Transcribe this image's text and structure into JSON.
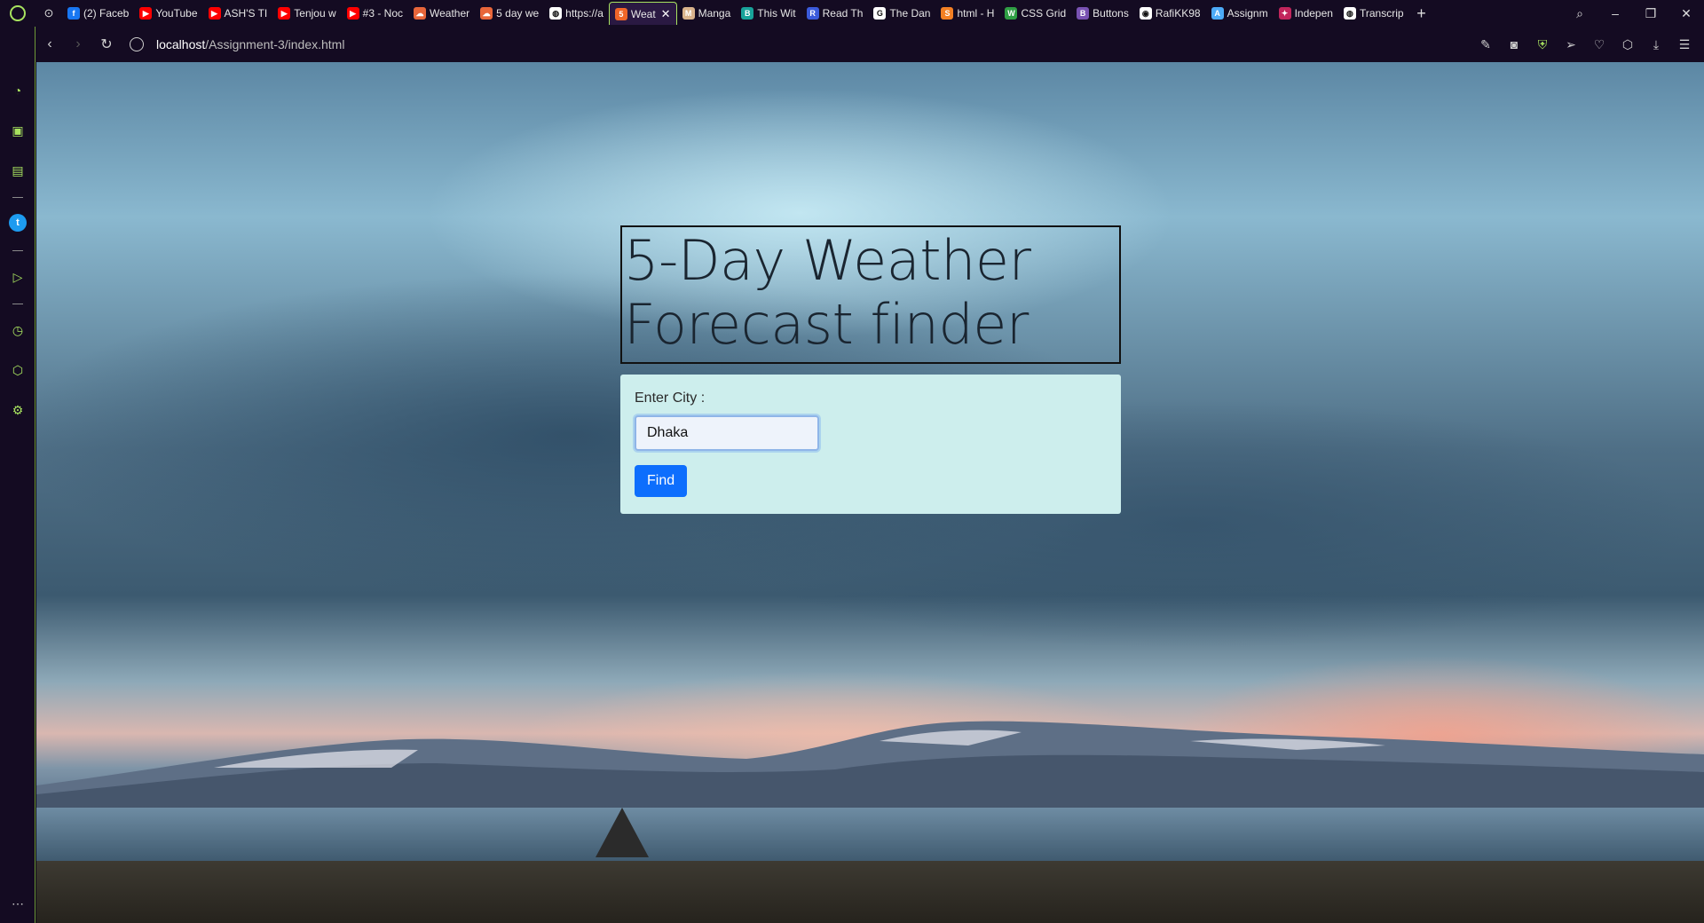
{
  "browser": {
    "tabs": [
      {
        "label": "(2) Faceb",
        "fav_color": "#1877f2",
        "fav_glyph": "f",
        "icon": "facebook-icon"
      },
      {
        "label": "YouTube",
        "fav_color": "#ff0000",
        "fav_glyph": "▶",
        "icon": "youtube-icon"
      },
      {
        "label": "ASH'S TI",
        "fav_color": "#ff0000",
        "fav_glyph": "▶",
        "icon": "youtube-icon"
      },
      {
        "label": "Tenjou w",
        "fav_color": "#ff0000",
        "fav_glyph": "▶",
        "icon": "youtube-icon"
      },
      {
        "label": "#3 - Noc",
        "fav_color": "#ff0000",
        "fav_glyph": "▶",
        "icon": "youtube-icon"
      },
      {
        "label": "Weather",
        "fav_color": "#e8663a",
        "fav_glyph": "☁",
        "icon": "weather-icon"
      },
      {
        "label": "5 day we",
        "fav_color": "#e8663a",
        "fav_glyph": "☁",
        "icon": "weather-icon"
      },
      {
        "label": "https://a",
        "fav_color": "#ffffff",
        "fav_glyph": "◍",
        "icon": "globe-icon"
      },
      {
        "label": "Weat",
        "fav_color": "#f06529",
        "fav_glyph": "5",
        "icon": "html-icon",
        "active": true
      },
      {
        "label": "Manga",
        "fav_color": "#d9b38c",
        "fav_glyph": "M",
        "icon": "manga-icon"
      },
      {
        "label": "This Wit",
        "fav_color": "#18a39a",
        "fav_glyph": "B",
        "icon": "book-icon"
      },
      {
        "label": "Read Th",
        "fav_color": "#3b5bdb",
        "fav_glyph": "R",
        "icon": "reader-icon"
      },
      {
        "label": "The Dan",
        "fav_color": "#ffffff",
        "fav_glyph": "G",
        "icon": "google-icon"
      },
      {
        "label": "html - H",
        "fav_color": "#f48024",
        "fav_glyph": "S",
        "icon": "stackoverflow-icon"
      },
      {
        "label": "CSS Grid",
        "fav_color": "#2f9e44",
        "fav_glyph": "W",
        "icon": "w3schools-icon"
      },
      {
        "label": "Buttons",
        "fav_color": "#7952b3",
        "fav_glyph": "B",
        "icon": "bootstrap-icon"
      },
      {
        "label": "RafiKK98",
        "fav_color": "#ffffff",
        "fav_glyph": "◉",
        "icon": "github-icon"
      },
      {
        "label": "Assignm",
        "fav_color": "#4dabf7",
        "fav_glyph": "A",
        "icon": "classroom-icon"
      },
      {
        "label": "Indepen",
        "fav_color": "#c2255c",
        "fav_glyph": "✦",
        "icon": "star-icon"
      },
      {
        "label": "Transcrip",
        "fav_color": "#ffffff",
        "fav_glyph": "◍",
        "icon": "globe-icon"
      }
    ],
    "address": {
      "host": "localhost",
      "path": "/Assignment-3/index.html"
    }
  },
  "app": {
    "title": "5-Day Weather Forecast finder",
    "city_label": "Enter City :",
    "city_value": "Dhaka",
    "find_label": "Find"
  },
  "colors": {
    "accent": "#a8e35f",
    "button": "#0d6efd",
    "card": "#cdeeed"
  }
}
